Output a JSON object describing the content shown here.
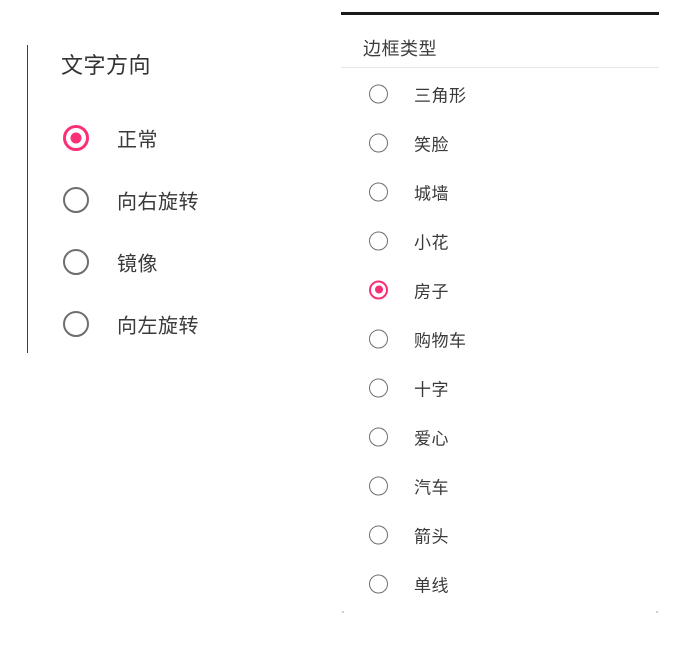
{
  "theme": {
    "accent_color": "#fb2e78",
    "radio_unselected_color": "#6e6e6e",
    "text_color": "#3a3a3a",
    "background": "#ffffff",
    "top_bar_color": "#1a1a1a",
    "divider_color": "#e8e8e8"
  },
  "text_direction_panel": {
    "title": "文字方向",
    "selected_index": 0,
    "options": [
      {
        "label": "正常",
        "selected": true,
        "icon": "radio-selected-icon"
      },
      {
        "label": "向右旋转",
        "selected": false,
        "icon": "radio-unselected-icon"
      },
      {
        "label": "镜像",
        "selected": false,
        "icon": "radio-unselected-icon"
      },
      {
        "label": "向左旋转",
        "selected": false,
        "icon": "radio-unselected-icon"
      }
    ]
  },
  "border_type_panel": {
    "title": "边框类型",
    "selected_index": 4,
    "options": [
      {
        "label": "三角形",
        "selected": false,
        "icon": "radio-unselected-icon"
      },
      {
        "label": "笑脸",
        "selected": false,
        "icon": "radio-unselected-icon"
      },
      {
        "label": "城墙",
        "selected": false,
        "icon": "radio-unselected-icon"
      },
      {
        "label": "小花",
        "selected": false,
        "icon": "radio-unselected-icon"
      },
      {
        "label": "房子",
        "selected": true,
        "icon": "radio-selected-icon"
      },
      {
        "label": "购物车",
        "selected": false,
        "icon": "radio-unselected-icon"
      },
      {
        "label": "十字",
        "selected": false,
        "icon": "radio-unselected-icon"
      },
      {
        "label": "爱心",
        "selected": false,
        "icon": "radio-unselected-icon"
      },
      {
        "label": "汽车",
        "selected": false,
        "icon": "radio-unselected-icon"
      },
      {
        "label": "箭头",
        "selected": false,
        "icon": "radio-unselected-icon"
      },
      {
        "label": "单线",
        "selected": false,
        "icon": "radio-unselected-icon"
      }
    ]
  }
}
